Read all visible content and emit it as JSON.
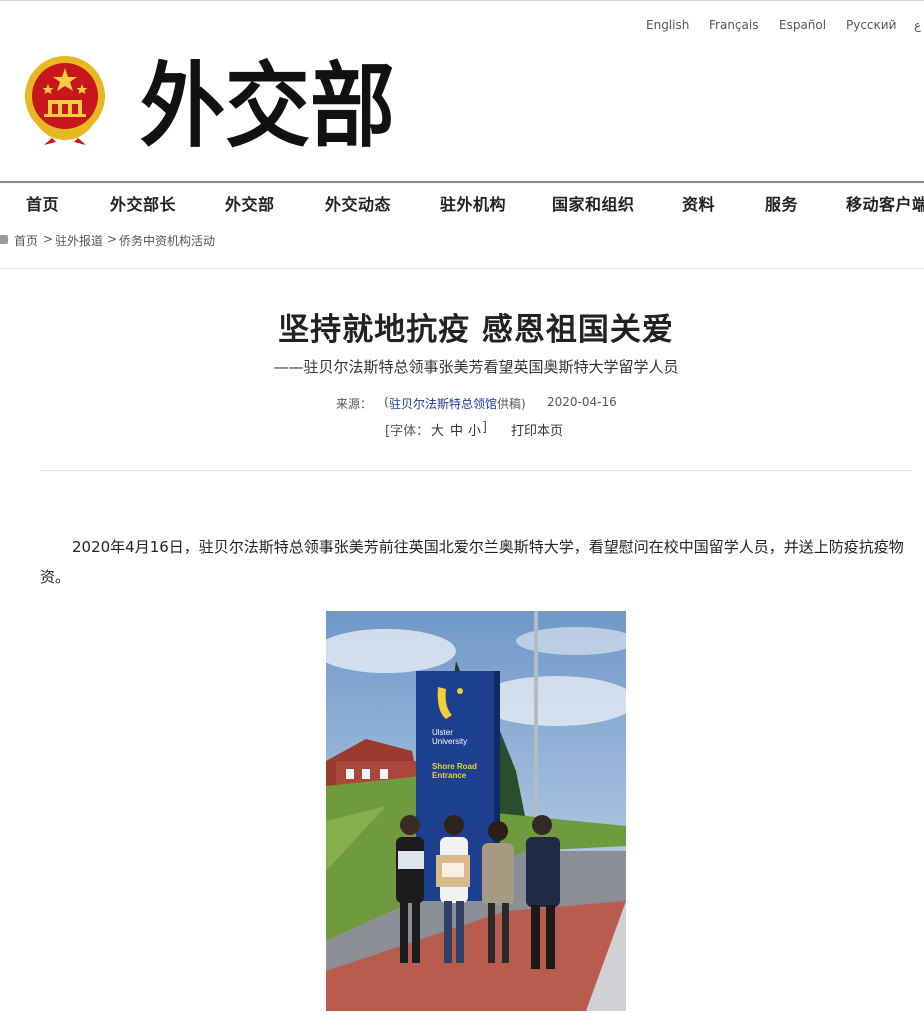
{
  "languages": [
    "English",
    "Français",
    "Español",
    "Русский",
    "ع"
  ],
  "site_title": "外交部",
  "nav": [
    "首页",
    "外交部长",
    "外交部",
    "外交动态",
    "驻外机构",
    "国家和组织",
    "资料",
    "服务",
    "移动客户端"
  ],
  "breadcrumb": {
    "home": "首页",
    "sep1": ">",
    "section": "驻外报道",
    "sep2": ">",
    "category": "侨务中资机构活动"
  },
  "article": {
    "title": "坚持就地抗疫 感恩祖国关爱",
    "subtitle": "——驻贝尔法斯特总领事张美芳看望英国奥斯特大学留学人员",
    "source_label": "来源：",
    "source_open": "(",
    "source_link": "驻贝尔法斯特总领馆",
    "source_suffix": "供稿)",
    "date": "2020-04-16",
    "font_label": "[字体：",
    "font_large": "大",
    "font_medium": "中",
    "font_small": "小",
    "font_close": "]",
    "print_label": "打印本页",
    "paragraph": "2020年4月16日，驻贝尔法斯特总领事张美芳前往英国北爱尔兰奥斯特大学，看望慰问在校中国留学人员，并送上防疫抗疫物资。"
  },
  "photo_sign": {
    "brand1": "Ulster",
    "brand2": "University",
    "entrance1": "Shore Road",
    "entrance2": "Entrance"
  },
  "colors": {
    "nav_border": "#8a8a8a",
    "link_blue": "#1a3aa0",
    "sign_blue": "#1c3f8f",
    "emblem_red": "#c8161d",
    "emblem_gold": "#e8b820"
  },
  "icons": {
    "home": "home-icon",
    "emblem": "national-emblem-icon"
  }
}
